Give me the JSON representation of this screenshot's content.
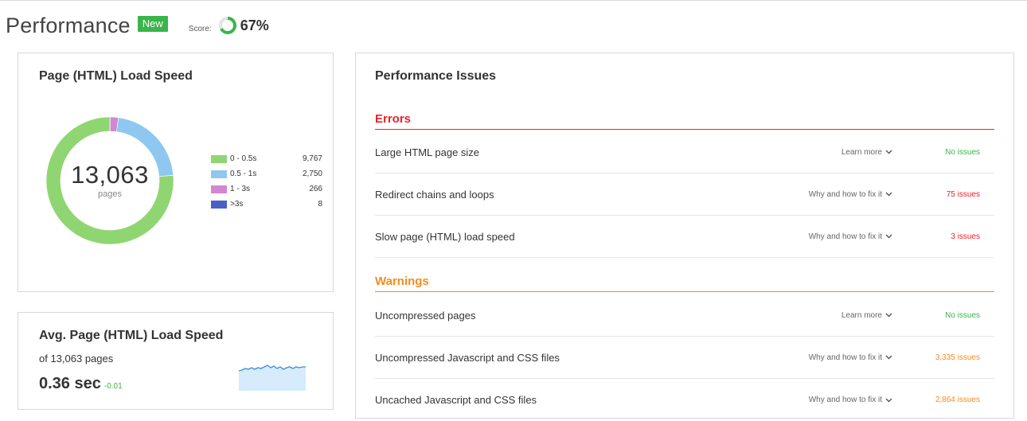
{
  "header": {
    "title": "Performance",
    "badge": "New",
    "score_label": "Score:",
    "score_value": "67%",
    "score_fraction": 0.67,
    "score_color": "#3ab54a"
  },
  "load_speed": {
    "title": "Page (HTML) Load Speed",
    "total": "13,063",
    "unit": "pages",
    "legend": [
      {
        "label": "0 - 0.5s",
        "value": "9,767",
        "color": "#8fd672"
      },
      {
        "label": "0.5 - 1s",
        "value": "2,750",
        "color": "#8ec8f0"
      },
      {
        "label": "1 - 3s",
        "value": "266",
        "color": "#d088d0"
      },
      {
        "label": ">3s",
        "value": "8",
        "color": "#4a5fc8"
      }
    ]
  },
  "avg_speed": {
    "title": "Avg. Page (HTML) Load Speed",
    "subtitle": "of 13,063 pages",
    "value": "0.36 sec",
    "delta": "-0.01",
    "delta_color": "#3ab54a"
  },
  "issues": {
    "title": "Performance Issues",
    "errors": {
      "label": "Errors",
      "color": "#e8232a",
      "rows": [
        {
          "name": "Large HTML page size",
          "help": "Learn more",
          "status": "No issues",
          "status_color": "#3ab54a"
        },
        {
          "name": "Redirect chains and loops",
          "help": "Why and how to fix it",
          "status": "75 issues",
          "status_color": "#e8232a"
        },
        {
          "name": "Slow page (HTML) load speed",
          "help": "Why and how to fix it",
          "status": "3 issues",
          "status_color": "#e8232a"
        }
      ]
    },
    "warnings": {
      "label": "Warnings",
      "color": "#f48c21",
      "rows": [
        {
          "name": "Uncompressed pages",
          "help": "Learn more",
          "status": "No issues",
          "status_color": "#3ab54a"
        },
        {
          "name": "Uncompressed Javascript and CSS files",
          "help": "Why and how to fix it",
          "status": "3,335 issues",
          "status_color": "#f48c21"
        },
        {
          "name": "Uncached Javascript and CSS files",
          "help": "Why and how to fix it",
          "status": "2,864 issues",
          "status_color": "#f48c21"
        }
      ]
    }
  }
}
